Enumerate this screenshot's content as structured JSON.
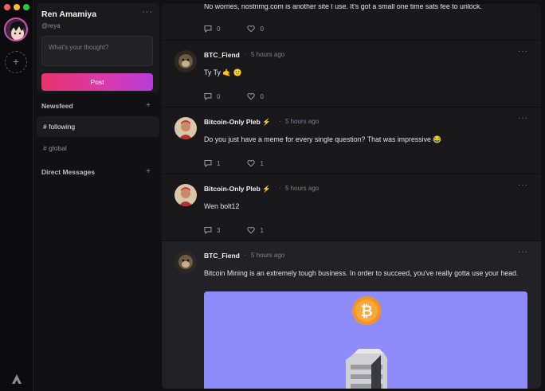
{
  "window": {
    "traffic_lights": [
      "close",
      "minimize",
      "maximize"
    ]
  },
  "rail": {
    "add_label": "+",
    "accent_color": "#d64fb8"
  },
  "profile": {
    "name": "Ren Amamiya",
    "handle": "@reya",
    "menu_label": "···",
    "placeholder": "What's your thought?",
    "post_label": "Post"
  },
  "sidebar": {
    "newsfeed_label": "Newsfeed",
    "newsfeed_add": "+",
    "items": [
      {
        "label": "# following",
        "active": true
      },
      {
        "label": "# global",
        "active": false
      }
    ],
    "dm_label": "Direct Messages",
    "dm_add": "+"
  },
  "feed": {
    "posts": [
      {
        "author": "",
        "time": "",
        "content": "No worries, nostrimg.com is another site I use. It's got a small one time sats fee to unlock.",
        "replies": "0",
        "likes": "0"
      },
      {
        "author": "BTC_Fiend",
        "time": "5 hours ago",
        "content": "Ty Ty 🤙 🙂",
        "replies": "0",
        "likes": "0"
      },
      {
        "author": "Bitcoin-Only Pleb ⚡",
        "time": "5 hours ago",
        "content": "Do you just have a meme for every single question? That was impressive 😂",
        "replies": "1",
        "likes": "1"
      },
      {
        "author": "Bitcoin-Only Pleb ⚡",
        "time": "5 hours ago",
        "content": "Wen bolt12",
        "replies": "3",
        "likes": "1"
      },
      {
        "author": "BTC_Fiend",
        "time": "5 hours ago",
        "content": "Bitcoin Mining is an extremely tough business. In order to succeed, you've really gotta use your head.",
        "replies": "",
        "likes": ""
      }
    ],
    "separator": "·",
    "menu_label": "···",
    "image_bg": "#8e8cfb"
  }
}
